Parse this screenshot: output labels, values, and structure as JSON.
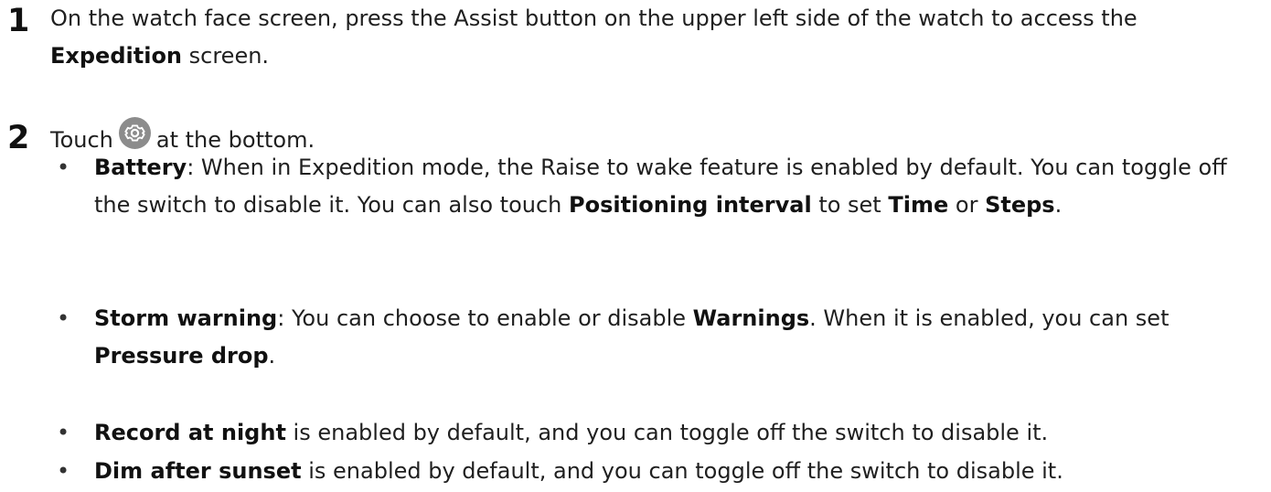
{
  "steps": [
    {
      "number": "1",
      "text_before": "On the watch face screen, press the Assist button on the upper left side of the watch to access the ",
      "bold": "Expedition",
      "text_after": " screen."
    },
    {
      "number": "2",
      "text_before": "Touch",
      "icon": "settings-gear-icon",
      "text_after": "at the bottom."
    }
  ],
  "bullet_marker": "•",
  "bullets": [
    {
      "segments": [
        {
          "text": "Battery",
          "bold": true
        },
        {
          "text": ": When in Expedition mode, the Raise to wake feature is enabled by default. You can toggle off the switch to disable it. You can also touch ",
          "bold": false
        },
        {
          "text": "Positioning interval",
          "bold": true
        },
        {
          "text": " to set ",
          "bold": false
        },
        {
          "text": "Time",
          "bold": true
        },
        {
          "text": " or ",
          "bold": false
        },
        {
          "text": "Steps",
          "bold": true
        },
        {
          "text": ".",
          "bold": false
        }
      ]
    },
    {
      "segments": [
        {
          "text": "Storm warning",
          "bold": true
        },
        {
          "text": ": You can choose to enable or disable ",
          "bold": false
        },
        {
          "text": "Warnings",
          "bold": true
        },
        {
          "text": ". When it is enabled, you can set ",
          "bold": false
        },
        {
          "text": "Pressure drop",
          "bold": true
        },
        {
          "text": ".",
          "bold": false
        }
      ]
    },
    {
      "segments": [
        {
          "text": "Record at night",
          "bold": true
        },
        {
          "text": " is enabled by default, and you can toggle off the switch to disable it.",
          "bold": false
        }
      ]
    },
    {
      "segments": [
        {
          "text": "Dim after sunset",
          "bold": true
        },
        {
          "text": " is enabled by default, and you can toggle off the switch to disable it.",
          "bold": false
        }
      ]
    }
  ],
  "colors": {
    "text": "#1f1f1f",
    "icon_background": "#8c8c8c",
    "icon_foreground": "#ffffff"
  }
}
